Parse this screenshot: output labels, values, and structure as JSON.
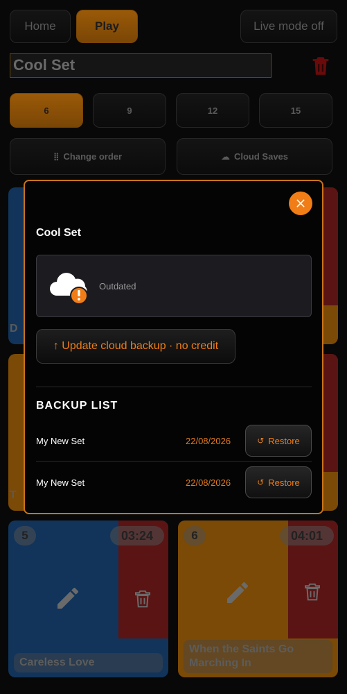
{
  "nav": {
    "home": "Home",
    "play": "Play",
    "live_mode": "Live mode off"
  },
  "set_title": "Cool Set",
  "size_options": [
    "6",
    "9",
    "12",
    "15"
  ],
  "actions": {
    "change_order": "Change order",
    "cloud_saves": "Cloud Saves"
  },
  "cards": [
    {
      "number": "5",
      "duration": "03:24",
      "title": "Careless Love"
    },
    {
      "number": "6",
      "duration": "04:01",
      "title": "When the Saints Go Marching In"
    }
  ],
  "modal": {
    "title": "Cool Set",
    "status": "Outdated",
    "update_label": "↑ Update cloud backup · no credit",
    "backup_heading": "BACKUP LIST",
    "restore_label": "Restore",
    "backups": [
      {
        "name": "My New Set",
        "date": "22/08/2026"
      },
      {
        "name": "My New Set",
        "date": "22/08/2026"
      }
    ]
  },
  "colors": {
    "accent": "#f07d16",
    "blue_card": "#12345a",
    "orange_card": "#7a4a06",
    "red_side": "#5a1414"
  }
}
